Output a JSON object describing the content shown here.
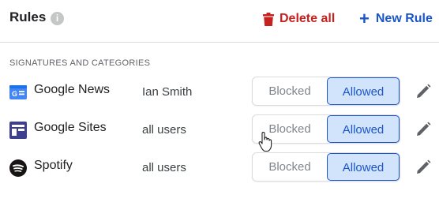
{
  "header": {
    "title": "Rules",
    "info_icon": "info-icon",
    "delete_label": "Delete all",
    "new_label": "New Rule"
  },
  "section": {
    "label": "SIGNATURES AND CATEGORIES"
  },
  "rules": [
    {
      "app": "Google News",
      "icon": "google-news-icon",
      "users": "Ian Smith",
      "blocked_label": "Blocked",
      "allowed_label": "Allowed",
      "selected": "Allowed"
    },
    {
      "app": "Google Sites",
      "icon": "google-sites-icon",
      "users": "all users",
      "blocked_label": "Blocked",
      "allowed_label": "Allowed",
      "selected": "Allowed"
    },
    {
      "app": "Spotify",
      "icon": "spotify-icon",
      "users": "all users",
      "blocked_label": "Blocked",
      "allowed_label": "Allowed",
      "selected": "Allowed"
    }
  ],
  "colors": {
    "danger": "#c5221f",
    "accent": "#1a56c7",
    "selected_bg": "#d2e3fc"
  }
}
